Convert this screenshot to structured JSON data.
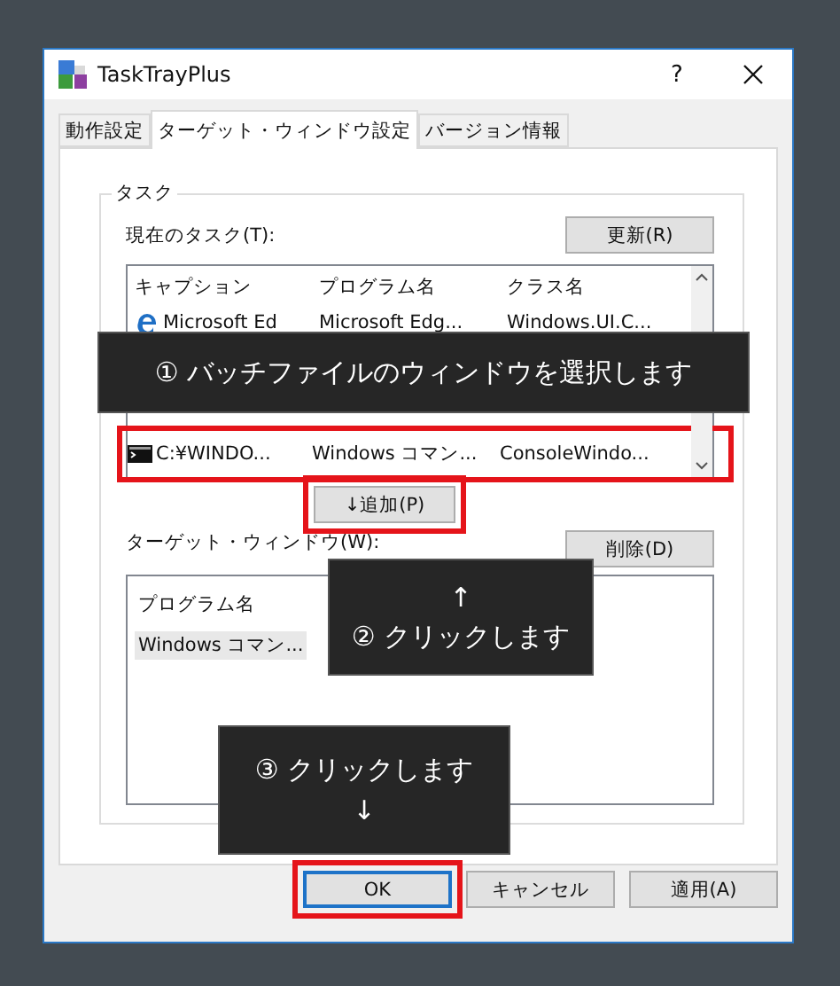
{
  "window": {
    "title": "TaskTrayPlus",
    "help": "?"
  },
  "tabs": [
    {
      "label": "動作設定",
      "selected": false
    },
    {
      "label": "ターゲット・ウィンドウ設定",
      "selected": true
    },
    {
      "label": "バージョン情報",
      "selected": false
    }
  ],
  "group": {
    "title": "タスク",
    "current_label": "現在のタスク(T):",
    "refresh_button": "更新(R)",
    "task_list": {
      "columns": [
        "キャプション",
        "プログラム名",
        "クラス名"
      ],
      "rows": [
        {
          "caption": "Microsoft Ed",
          "program": "Microsoft Edg...",
          "class": "Windows.UI.C...",
          "highlighted": false
        },
        {
          "caption": "C:¥WINDO...",
          "program": "Windows コマン...",
          "class": "ConsoleWindo...",
          "highlighted": true
        }
      ]
    },
    "add_button": {
      "label": "↓追加(P)",
      "highlighted": true
    },
    "target_label": "ターゲット・ウィンドウ(W):",
    "delete_button": "削除(D)",
    "target_list": {
      "columns": [
        "プログラム名"
      ],
      "rows": [
        {
          "program": "Windows コマン...",
          "selected": true
        }
      ]
    }
  },
  "callouts": [
    {
      "lines": [
        "① バッチファイルのウィンドウを選択します"
      ]
    },
    {
      "lines": [
        "↑",
        "② クリックします"
      ]
    },
    {
      "lines": [
        "③ クリックします",
        "↓"
      ]
    }
  ],
  "buttons": [
    {
      "label": "OK",
      "default": true,
      "highlighted": true
    },
    {
      "label": "キャンセル",
      "default": false,
      "highlighted": false
    },
    {
      "label": "適用(A)",
      "default": false,
      "highlighted": false
    }
  ]
}
